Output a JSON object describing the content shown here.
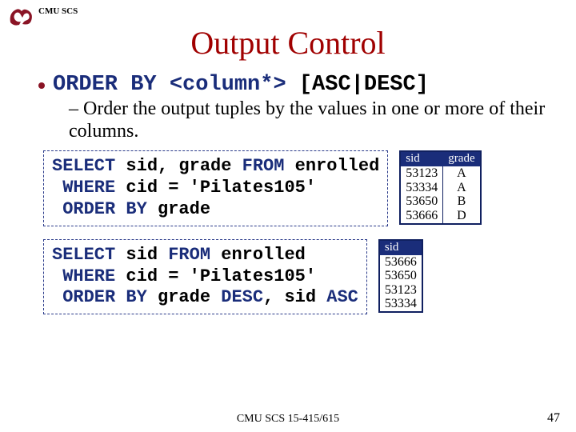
{
  "header_label": "CMU SCS",
  "title": "Output Control",
  "syntax": {
    "kw1": "ORDER BY",
    "arg": "<column*>",
    "opts": "[ASC|DESC]"
  },
  "description": "Order the output tuples by the values in one or more of their columns.",
  "sql1": {
    "line1_a": "SELECT",
    "line1_b": " sid, grade ",
    "line1_c": "FROM",
    "line1_d": " enrolled",
    "line2_a": " WHERE",
    "line2_b": " cid = 'Pilates105'",
    "line3_a": " ORDER BY",
    "line3_b": " grade"
  },
  "table1": {
    "headers": [
      "sid",
      "grade"
    ],
    "rows": [
      [
        "53123",
        "A"
      ],
      [
        "53334",
        "A"
      ],
      [
        "53650",
        "B"
      ],
      [
        "53666",
        "D"
      ]
    ]
  },
  "sql2": {
    "line1_a": "SELECT",
    "line1_b": " sid ",
    "line1_c": "FROM",
    "line1_d": " enrolled",
    "line2_a": " WHERE",
    "line2_b": " cid = 'Pilates105'",
    "line3_a": " ORDER BY",
    "line3_b": " grade ",
    "line3_c": "DESC",
    "line3_d": ", sid ",
    "line3_e": "ASC"
  },
  "table2": {
    "headers": [
      "sid"
    ],
    "rows": [
      [
        "53666"
      ],
      [
        "53650"
      ],
      [
        "53123"
      ],
      [
        "53334"
      ]
    ]
  },
  "footer": "CMU SCS 15-415/615",
  "page": "47"
}
